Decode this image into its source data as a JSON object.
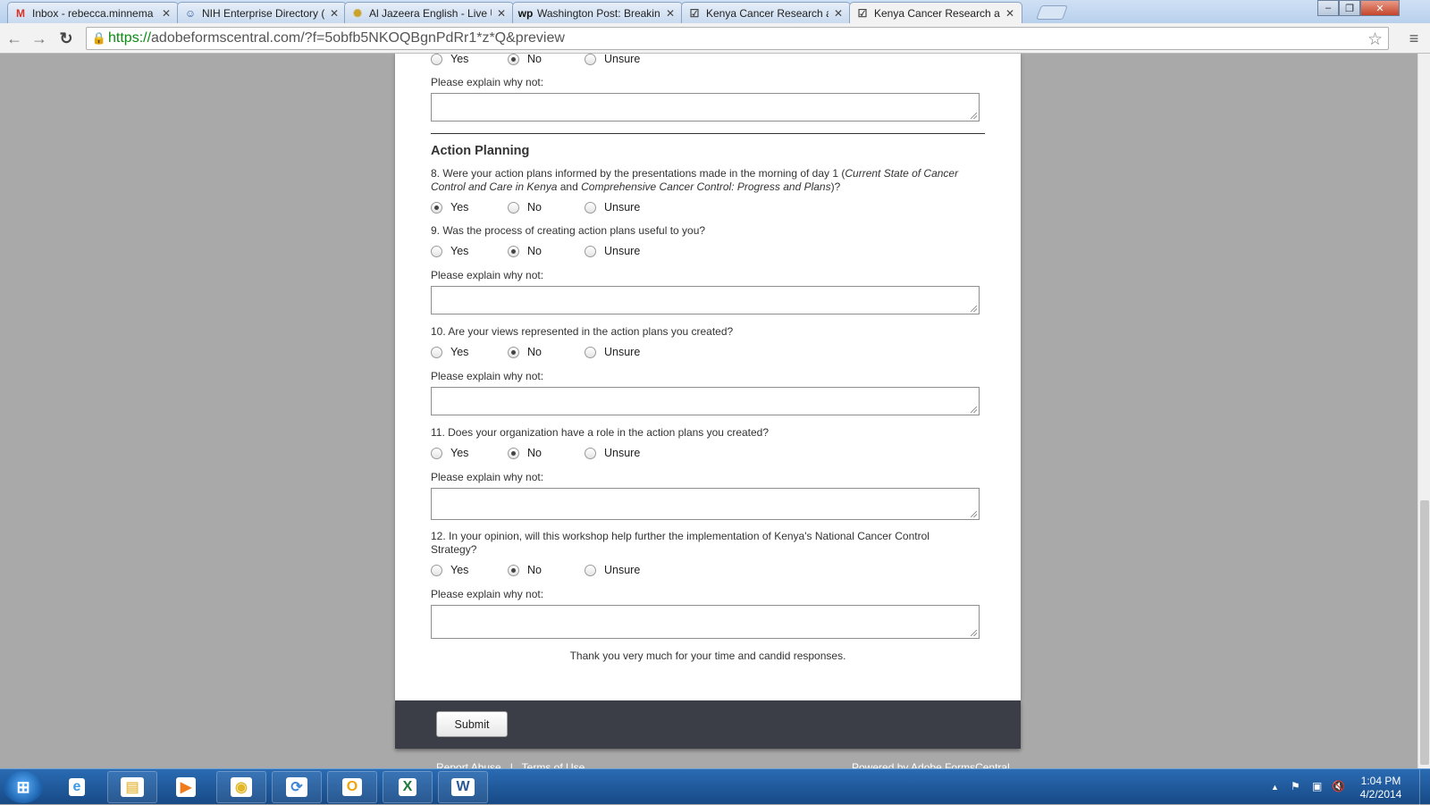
{
  "browser": {
    "tabs": [
      {
        "icon": "gmail-icon",
        "glyph": "M",
        "color": "#d93025",
        "title": "Inbox - rebecca.minnema",
        "active": false
      },
      {
        "icon": "directory-icon",
        "glyph": "☺",
        "color": "#2c5aa0",
        "title": "NIH Enterprise Directory (",
        "active": false
      },
      {
        "icon": "aljazeera-icon",
        "glyph": "✺",
        "color": "#c9a227",
        "title": "Al Jazeera English - Live U",
        "active": false
      },
      {
        "icon": "washington-post-icon",
        "glyph": "wp",
        "color": "#111111",
        "title": "Washington Post: Breaking",
        "active": false
      },
      {
        "icon": "form-icon",
        "glyph": "☑",
        "color": "#444444",
        "title": "Kenya Cancer Research an",
        "active": false
      },
      {
        "icon": "form-icon",
        "glyph": "☑",
        "color": "#444444",
        "title": "Kenya Cancer Research an",
        "active": true
      }
    ],
    "close_glyph": "✕",
    "url_scheme": "https://",
    "url_rest": "adobeformscentral.com/?f=5obfb5NKOQBgnPdRr1*z*Q&preview",
    "window_controls": {
      "minimize": "‒",
      "maximize": "❐",
      "close": "✕"
    },
    "back_glyph": "←",
    "forward_glyph": "→",
    "reload_glyph": "↻",
    "star_glyph": "☆",
    "menu_glyph": "≡"
  },
  "form": {
    "top_question": {
      "options": [
        "Yes",
        "No",
        "Unsure"
      ],
      "selected": 1,
      "explain_label": "Please explain why not:"
    },
    "section_title": "Action Planning",
    "questions": [
      {
        "text_html": "8. Were your action plans informed by the presentations made in the morning of day 1 (<i>Current State of Cancer Control and Care in Kenya</i> and <i>Comprehensive Cancer Control: Progress and Plans</i>)?",
        "options": [
          "Yes",
          "No",
          "Unsure"
        ],
        "selected": 0,
        "explain_label": ""
      },
      {
        "text": "9. Was the process of creating action plans useful to you?",
        "options": [
          "Yes",
          "No",
          "Unsure"
        ],
        "selected": 1,
        "explain_label": "Please explain why not:"
      },
      {
        "text": "10. Are your views represented in the action plans you created?",
        "options": [
          "Yes",
          "No",
          "Unsure"
        ],
        "selected": 1,
        "explain_label": "Please explain why not:"
      },
      {
        "text": "11. Does your organization have a role in the action plans you created?",
        "options": [
          "Yes",
          "No",
          "Unsure"
        ],
        "selected": 1,
        "explain_label": "Please explain why not:"
      },
      {
        "text": "12. In your opinion, will this workshop help further the implementation of Kenya's National Cancer Control Strategy?",
        "options": [
          "Yes",
          "No",
          "Unsure"
        ],
        "selected": 1,
        "explain_label": "Please explain why not:"
      }
    ],
    "thanks": "Thank you very much for your time and candid responses.",
    "submit_label": "Submit"
  },
  "footer": {
    "report_abuse": "Report Abuse",
    "separator": "|",
    "terms": "Terms of Use",
    "powered_prefix": "Powered by ",
    "powered_link": "Adobe FormsCentral"
  },
  "taskbar": {
    "start_glyph": "⊞",
    "apps": [
      {
        "name": "internet-explorer-icon",
        "glyph": "e",
        "color": "#3a9bea",
        "pinned": false
      },
      {
        "name": "file-explorer-icon",
        "glyph": "▤",
        "color": "#e8c25a",
        "pinned": true
      },
      {
        "name": "media-player-icon",
        "glyph": "▶",
        "color": "#f07b1b",
        "pinned": false
      },
      {
        "name": "chrome-icon",
        "glyph": "◉",
        "color": "#e0b72a",
        "pinned": true
      },
      {
        "name": "sync-icon",
        "glyph": "⟳",
        "color": "#3f86d6",
        "pinned": true
      },
      {
        "name": "outlook-icon",
        "glyph": "O",
        "color": "#f0a30a",
        "pinned": true
      },
      {
        "name": "excel-icon",
        "glyph": "X",
        "color": "#1e7a3c",
        "pinned": true
      },
      {
        "name": "word-icon",
        "glyph": "W",
        "color": "#2b5797",
        "pinned": true
      }
    ],
    "tray": {
      "chevron": "▲",
      "flag": "⚑",
      "network": "▣",
      "volume": "🔇"
    },
    "time": "1:04 PM",
    "date": "4/2/2014"
  }
}
